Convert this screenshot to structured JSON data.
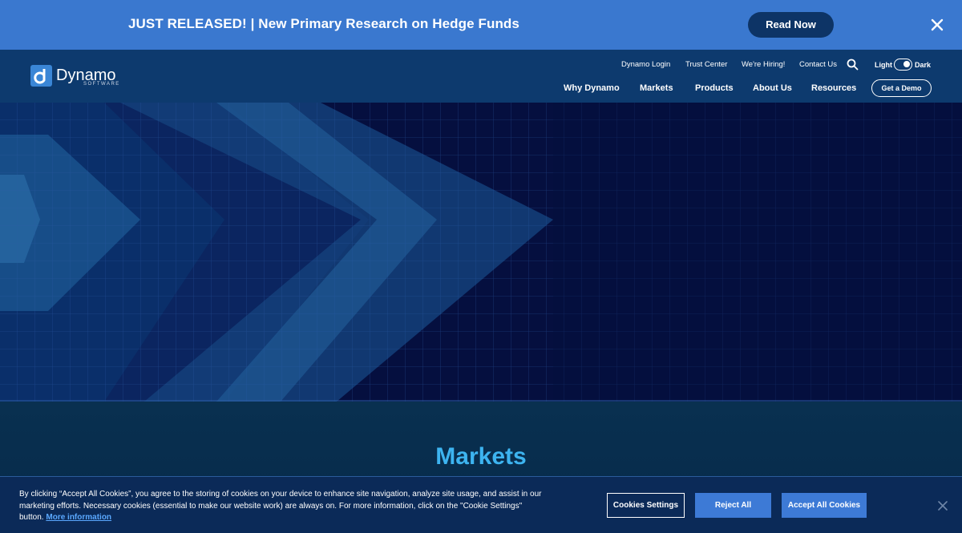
{
  "announcement": {
    "text": "JUST RELEASED! | New Primary Research on Hedge Funds",
    "button_label": "Read Now",
    "close_icon": "close-icon"
  },
  "brand": {
    "name": "Dynamo",
    "sub": "SOFTWARE"
  },
  "utility_nav": {
    "items": [
      "Dynamo Login",
      "Trust Center",
      "We're Hiring!",
      "Contact Us"
    ],
    "search_icon": "search-icon",
    "theme_light": "Light",
    "theme_dark": "Dark",
    "theme_mode": "dark"
  },
  "main_nav": {
    "items": [
      "Why Dynamo",
      "Markets",
      "Products",
      "About Us",
      "Resources"
    ],
    "demo_label": "Get a Demo"
  },
  "section": {
    "title": "Markets"
  },
  "cookie": {
    "text": "By clicking “Accept All Cookies”, you agree to the storing of cookies on your device to enhance site navigation, analyze site usage, and assist in our marketing efforts. Necessary cookies (essential to make our website work) are always on. For more information, click on the \"Cookie Settings\" button.",
    "link": "More information",
    "settings_label": "Cookies Settings",
    "reject_label": "Reject All",
    "accept_label": "Accept All Cookies"
  },
  "colors": {
    "announcement_bg": "#3a78cf",
    "header_bg": "#0d3a6e",
    "hero_bg": "#050f3f",
    "accent": "#3db4f0",
    "cookie_button": "#3d7ad6"
  }
}
